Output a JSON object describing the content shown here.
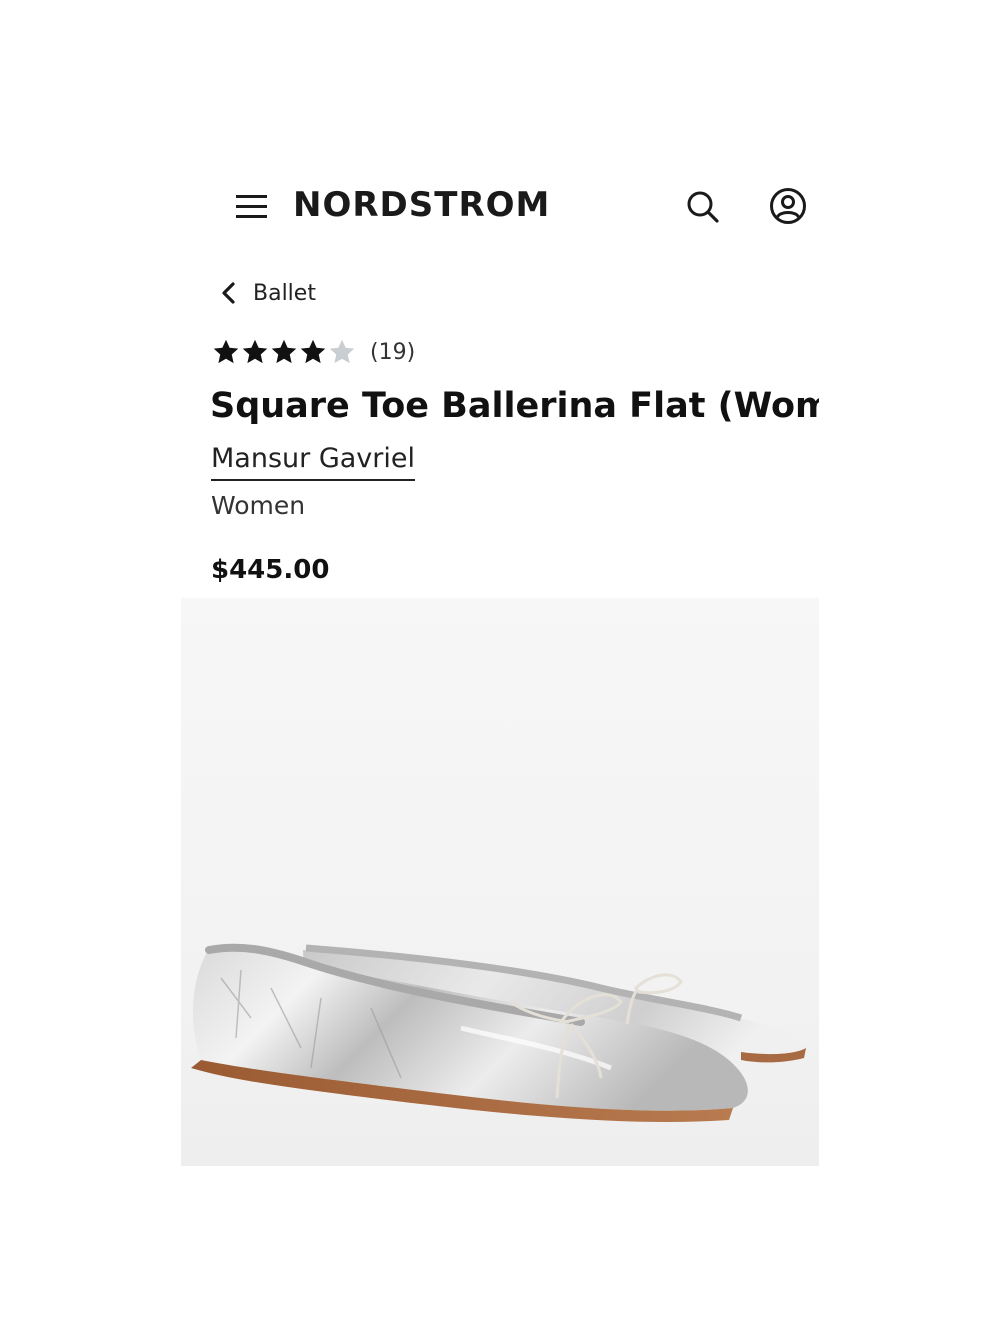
{
  "header": {
    "logo": "NORDSTROM",
    "menu_icon": "hamburger-menu-icon",
    "search_icon": "search-icon",
    "account_icon": "account-icon"
  },
  "breadcrumb": {
    "label": "Ballet",
    "icon": "chevron-left-icon"
  },
  "product": {
    "rating": 4,
    "rating_max": 5,
    "review_count": "(19)",
    "title": "Square Toe Ballerina Flat (Women)",
    "brand": "Mansur Gavriel",
    "category": "Women",
    "price": "$445.00",
    "image_alt": "silver metallic ballet flats"
  },
  "colors": {
    "star_filled": "#111111",
    "star_empty": "#c9ced2",
    "text": "#1a1a1a"
  }
}
